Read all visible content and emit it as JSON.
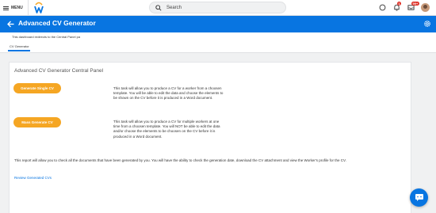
{
  "topbar": {
    "menu_label": "MENU",
    "search_placeholder": "Search",
    "icons": [
      "menu-icon",
      "workday-logo",
      "search-icon",
      "chat-icon",
      "bell-icon",
      "inbox-icon",
      "avatar"
    ],
    "notifications_count": "1",
    "inbox_count": "99+"
  },
  "header": {
    "title": "Advanced CV Generator",
    "background_color": "#0875e1"
  },
  "subheader": {
    "redirect_note": "This dashboard redirects to the Central Panel pa",
    "tab_label": "CV Generator"
  },
  "panel": {
    "title": "Advanced CV Generator Central Panel",
    "generate_single_label": "Generate Single CV",
    "generate_single_desc": "This task will allow you to produce a CV for a worker from a choosen template. You will be able to edit the data and choose the elements to be shown on the CV before it is produced in a Word document.",
    "mass_generate_label": "Mass Generate CV",
    "mass_generate_desc": "This task will allow you to produce a CV for multiple workers at one time from a choosen template. You will NOT be able to edit the data and/or choose the elements to be choosen on the CV before it is produced in a Word document.",
    "report_text": "This report will allow you to check all the documents that have been generated by you. You will have the ability to check the generation date, download the CV attachment and view the Worker's profile for the CV.",
    "review_link": "Review Generated CVs",
    "accent_color": "#f5a623"
  }
}
